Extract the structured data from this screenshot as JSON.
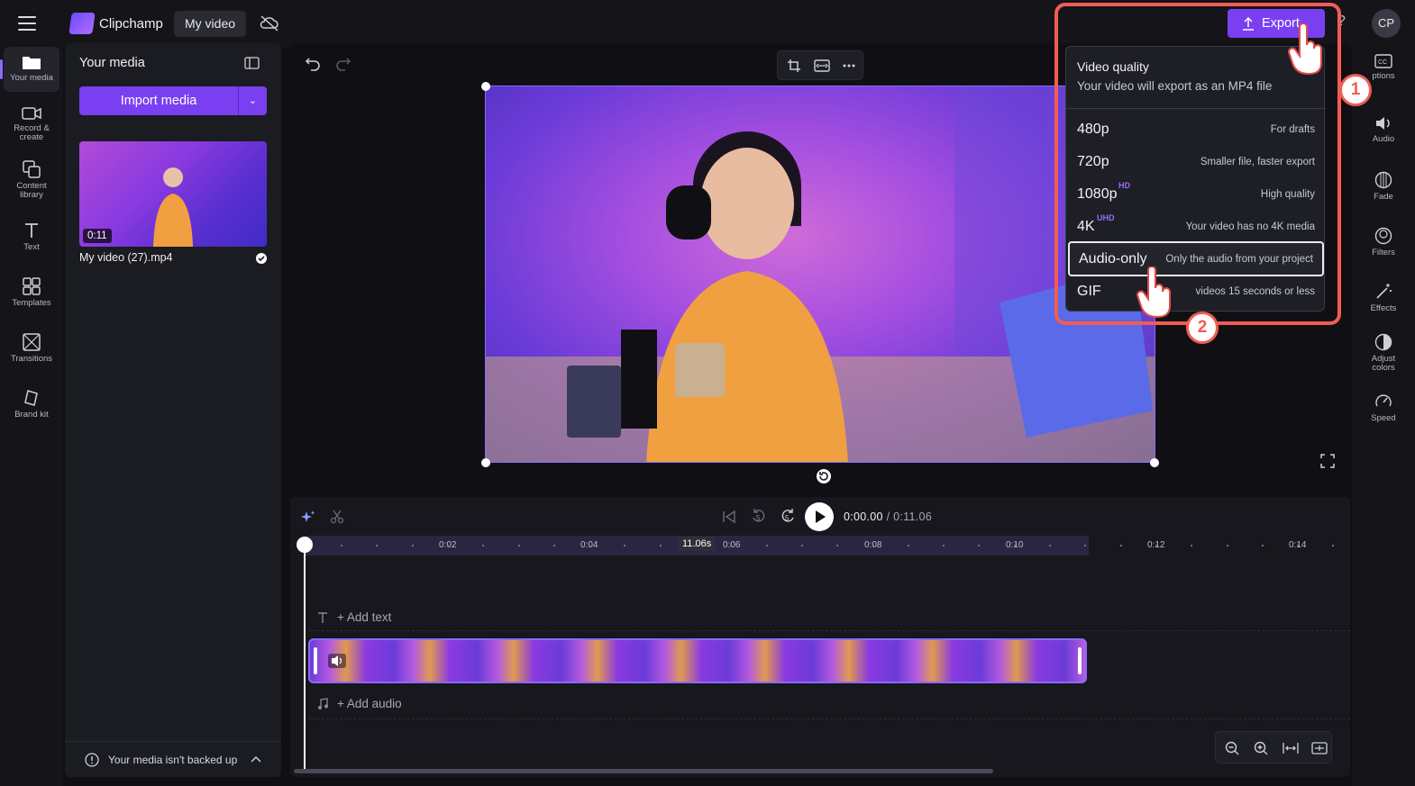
{
  "app": {
    "name": "Clipchamp",
    "project_name": "My video",
    "avatar_initials": "CP",
    "help_label": "?"
  },
  "left_rail": {
    "items": [
      {
        "label": "Your media",
        "icon": "folder-icon"
      },
      {
        "label": "Record &\ncreate",
        "icon": "camera-icon"
      },
      {
        "label": "Content\nlibrary",
        "icon": "library-icon"
      },
      {
        "label": "Text",
        "icon": "text-icon"
      },
      {
        "label": "Templates",
        "icon": "templates-icon"
      },
      {
        "label": "Transitions",
        "icon": "transitions-icon"
      },
      {
        "label": "Brand kit",
        "icon": "brand-kit-icon"
      }
    ]
  },
  "media_panel": {
    "title": "Your media",
    "import_label": "Import media",
    "file": {
      "name": "My video (27).mp4",
      "duration": "0:11"
    },
    "backup_text": "Your media isn't backed up"
  },
  "right_rail": {
    "items": [
      {
        "label": "ptions",
        "icon": "captions-icon"
      },
      {
        "label": "Audio",
        "icon": "audio-icon"
      },
      {
        "label": "Fade",
        "icon": "fade-icon"
      },
      {
        "label": "Filters",
        "icon": "filters-icon"
      },
      {
        "label": "Effects",
        "icon": "effects-icon"
      },
      {
        "label": "Adjust\ncolors",
        "icon": "adjust-colors-icon"
      },
      {
        "label": "Speed",
        "icon": "speed-icon"
      }
    ]
  },
  "export": {
    "button_label": "Export",
    "title": "Video quality",
    "subtitle": "Your video will export as an MP4 file",
    "options": [
      {
        "label": "480p",
        "badge": "",
        "desc": "For drafts"
      },
      {
        "label": "720p",
        "badge": "",
        "desc": "Smaller file, faster export"
      },
      {
        "label": "1080p",
        "badge": "HD",
        "desc": "High quality"
      },
      {
        "label": "4K",
        "badge": "UHD",
        "desc": "Your video has no 4K media"
      },
      {
        "label": "Audio-only",
        "badge": "",
        "desc": "Only the audio from your project"
      },
      {
        "label": "GIF",
        "badge": "",
        "desc": "videos 15 seconds or less"
      }
    ],
    "selected_index": 4,
    "step_labels": [
      "1",
      "2"
    ]
  },
  "timeline": {
    "current_time": "0:00.00",
    "total_time": "/ 0:11.06",
    "ruler_labels": [
      "0:02",
      "0:04",
      "0:06",
      "0:08",
      "0:10",
      "0:12",
      "0:14"
    ],
    "current_badge": "11.06s",
    "add_text": "+ Add text",
    "add_audio": "+ Add audio",
    "back_skip_label": "5",
    "fwd_skip_label": "5"
  },
  "colors": {
    "accent": "#7b3ff2",
    "highlight": "#f25c54",
    "bg": "#101014"
  }
}
